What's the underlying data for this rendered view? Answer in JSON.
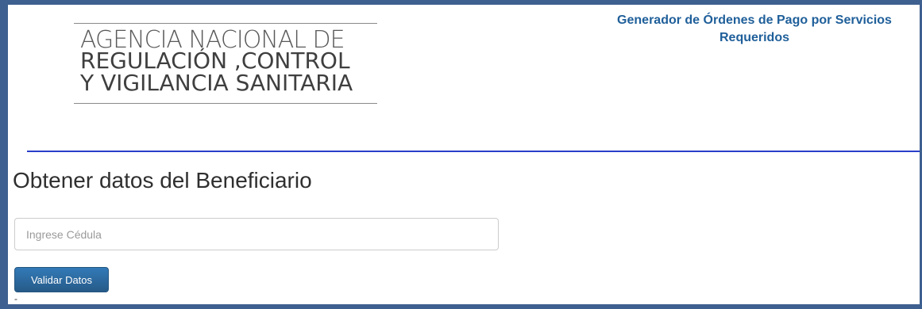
{
  "logo": {
    "line1": "AGENCIA NACIONAL DE",
    "line2": "REGULACIÓN ,CONTROL",
    "line3": "Y VIGILANCIA SANITARIA"
  },
  "header": {
    "title_line1": "Generador de Órdenes de Pago por Servicios",
    "title_line2": "Requeridos"
  },
  "main": {
    "heading": "Obtener datos del Beneficiario",
    "cedula_input": {
      "value": "",
      "placeholder": "Ingrese Cédula"
    },
    "validate_button_label": "Validar Datos",
    "footer_mark": "-"
  },
  "colors": {
    "frame_border": "#3e6090",
    "title_blue": "#1f5f9a",
    "divider_blue": "#2a3fc8",
    "button_blue": "#337ab7"
  }
}
